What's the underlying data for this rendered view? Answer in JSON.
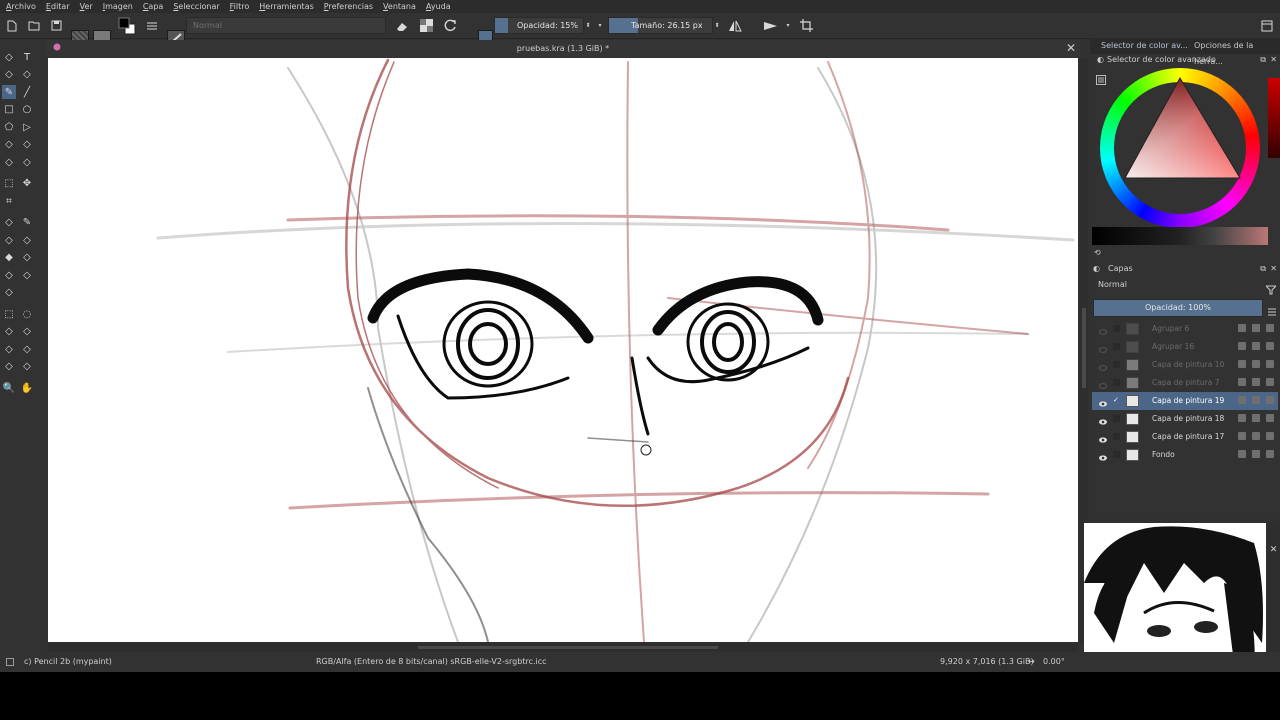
{
  "menu": [
    "Archivo",
    "Editar",
    "Ver",
    "Imagen",
    "Capa",
    "Seleccionar",
    "Filtro",
    "Herramientas",
    "Preferencias",
    "Ventana",
    "Ayuda"
  ],
  "toolbar": {
    "blend_mode": "Normal",
    "opacity_label": "Opacidad: 15%",
    "opacity_value": 15,
    "size_label": "Tamaño: 26.15 px"
  },
  "document": {
    "tab_title": "pruebas.kra (1.3 GiB) *"
  },
  "dock": {
    "tab_color_selector": "Selector de color av...",
    "tab_tool_options": "Opciones de la herra...",
    "color_panel_title": "Selector de color avanzado",
    "layers_panel_title": "Capas",
    "layers_blend_mode": "Normal",
    "layers_opacity_label": "Opacidad:  100%",
    "layers_opacity_value": 100
  },
  "layers": [
    {
      "name": "Agrupar 6",
      "visible": false,
      "type": "group"
    },
    {
      "name": "Agrupar 16",
      "visible": false,
      "type": "group"
    },
    {
      "name": "Capa de pintura 10",
      "visible": false,
      "type": "paint"
    },
    {
      "name": "Capa de pintura 7",
      "visible": false,
      "type": "paint"
    },
    {
      "name": "Capa de pintura 19",
      "visible": true,
      "type": "paint",
      "selected": true
    },
    {
      "name": "Capa de pintura 18",
      "visible": true,
      "type": "paint"
    },
    {
      "name": "Capa de pintura 17",
      "visible": true,
      "type": "paint"
    },
    {
      "name": "Fondo",
      "visible": true,
      "type": "background"
    }
  ],
  "status": {
    "brush": "c) Pencil 2b (mypaint)",
    "color_profile": "RGB/Alfa (Entero de 8 bits/canal)  sRGB-elle-V2-srgbtrc.icc",
    "image_size": "9,920 x 7,016 (1.3 GiB)",
    "rotation": "0.00°"
  },
  "colors": {
    "accent": "#56708f",
    "selected_layer": "#4c6687",
    "sketch_red": "#a84a4a",
    "bg": "#313131"
  },
  "icons": [
    "new-document-icon",
    "open-icon",
    "save-icon",
    "pattern-icon",
    "gradient-icon",
    "fg-bg-colors-icon",
    "brush-presets-icon",
    "brush-preview-icon",
    "eraser-icon",
    "alpha-lock-icon",
    "reload-icon",
    "mirror-horizontal-icon",
    "mirror-vertical-icon",
    "wrap-around-icon",
    "window-icon",
    "close-icon",
    "eye-icon",
    "filter-icon",
    "menu-icon",
    "brush-cursor-icon"
  ]
}
